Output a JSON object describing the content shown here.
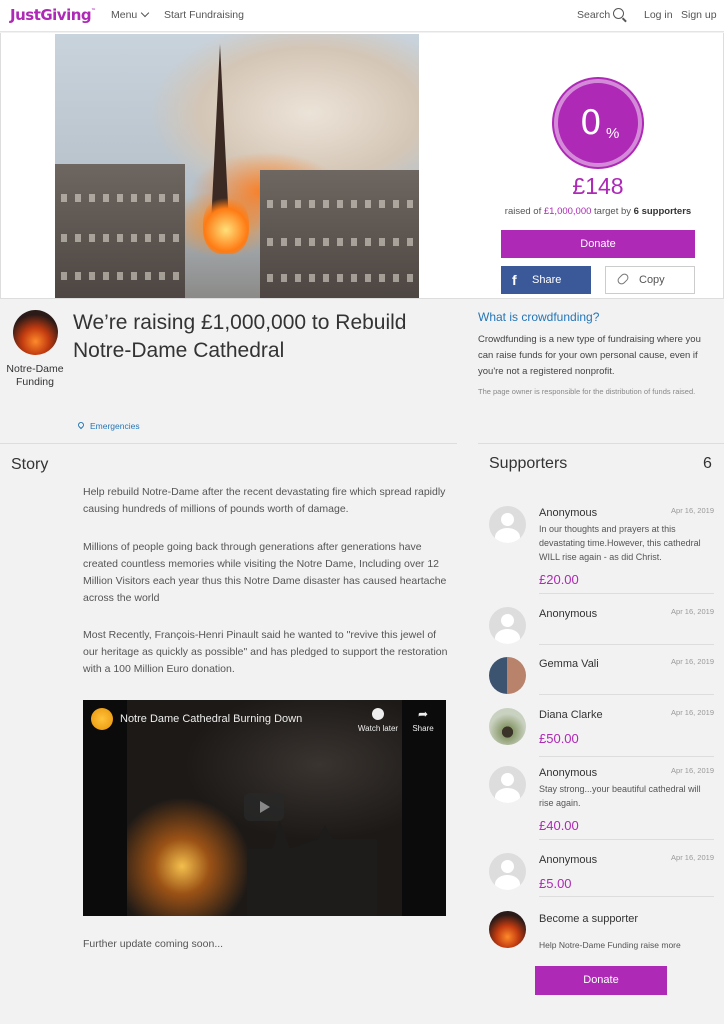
{
  "header": {
    "logo": "JustGiving",
    "menu_label": "Menu",
    "start_fundraising": "Start Fundraising",
    "search_label": "Search",
    "login": "Log in",
    "signup": "Sign up"
  },
  "progress": {
    "percent_value": "0",
    "percent_sign": "%",
    "percent_fraction": 0,
    "raised_amount": "£148",
    "raised_prefix": "raised of",
    "target": "£1,000,000",
    "target_by": "target by",
    "supporters_count_text": "6 supporters"
  },
  "actions": {
    "donate": "Donate",
    "share": "Share",
    "copy": "Copy"
  },
  "owner": {
    "name": "Notre-Dame Funding"
  },
  "page": {
    "title": "We’re raising £1,000,000 to Rebuild Notre-Dame Cathedral",
    "category": "Emergencies"
  },
  "crowdfunding": {
    "title": "What is crowdfunding?",
    "text": "Crowdfunding is a new type of fundraising where you can raise funds for your own personal cause, even if you're not a registered nonprofit.",
    "note": "The page owner is responsible for the distribution of funds raised."
  },
  "story": {
    "heading": "Story",
    "paragraphs": [
      "Help rebuild Notre-Dame after the recent devastating fire which spread rapidly causing hundreds of millions of pounds worth of damage.",
      "Millions of people going back through generations after generations have created countless memories while visiting the Notre Dame, Including over 12 Million Visitors each year thus this Notre Dame disaster has caused heartache across the world",
      "Most Recently, François-Henri Pinault said he wanted to \"revive this jewel of our heritage as quickly as possible\" and has pledged to support the restoration with a 100 Million Euro donation."
    ],
    "video": {
      "title": "Notre Dame Cathedral Burning Down",
      "watch_later": "Watch later",
      "share": "Share"
    },
    "footer": "Further update coming soon..."
  },
  "supporters": {
    "heading": "Supporters",
    "count": "6",
    "items": [
      {
        "name": "Anonymous",
        "date": "Apr 16, 2019",
        "message": "In our thoughts and prayers at this devastating time.However, this cathedral WILL rise again - as did Christ.",
        "amount": "£20.00",
        "avatar": "anonymous-avatar"
      },
      {
        "name": "Anonymous",
        "date": "Apr 16, 2019",
        "message": "",
        "amount": "",
        "avatar": "anonymous-avatar"
      },
      {
        "name": "Gemma Vali",
        "date": "Apr 16, 2019",
        "message": "",
        "amount": "",
        "avatar": "photo-avatar"
      },
      {
        "name": "Diana Clarke",
        "date": "Apr 16, 2019",
        "message": "",
        "amount": "£50.00",
        "avatar": "photo-avatar"
      },
      {
        "name": "Anonymous",
        "date": "Apr 16, 2019",
        "message": "Stay strong...your beautiful cathedral will rise again.",
        "amount": "£40.00",
        "avatar": "anonymous-avatar"
      },
      {
        "name": "Anonymous",
        "date": "Apr 16, 2019",
        "message": "",
        "amount": "£5.00",
        "avatar": "anonymous-avatar"
      }
    ],
    "become": {
      "title": "Become a supporter",
      "subtitle": "Help Notre-Dame Funding raise more"
    }
  },
  "colors": {
    "brand": "#ad29b6",
    "link": "#2476b6",
    "facebook": "#3b5998"
  }
}
